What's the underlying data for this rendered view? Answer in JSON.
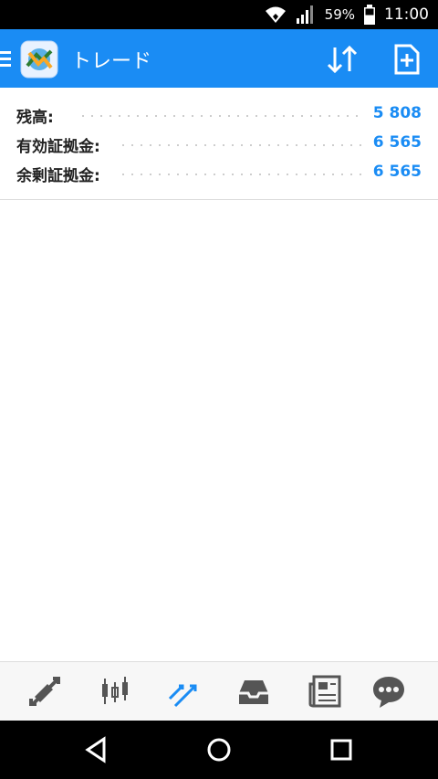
{
  "status_bar": {
    "battery_percent": "59%",
    "time": "11:00",
    "icons": [
      "wifi-icon",
      "signal-icon",
      "battery-icon"
    ]
  },
  "app_bar": {
    "title": "トレード",
    "background_color": "#1a8cf4",
    "icons": [
      "menu-icon",
      "metatrader-logo",
      "sort-icon",
      "new-order-icon"
    ]
  },
  "account_summary": {
    "rows": [
      {
        "label": "残高:",
        "value": "5 808"
      },
      {
        "label": "有効証拠金:",
        "value": "6 565"
      },
      {
        "label": "余剰証拠金:",
        "value": "6 565"
      }
    ],
    "value_color": "#1a8cf4"
  },
  "bottom_nav": {
    "items": [
      "quotes-icon",
      "chart-icon",
      "trade-icon",
      "history-icon",
      "news-icon",
      "chat-icon"
    ],
    "active_item": "trade-icon",
    "active_color": "#1a8cf4",
    "inactive_color": "#555555"
  },
  "android_nav": {
    "buttons": [
      "back-icon",
      "home-icon",
      "recents-icon"
    ]
  }
}
